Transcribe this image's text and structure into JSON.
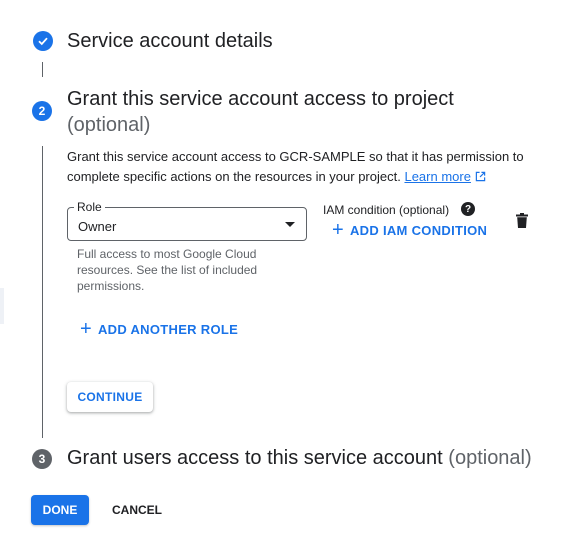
{
  "steps": [
    {
      "label": "Service account details",
      "state": "complete"
    },
    {
      "number": "2",
      "label": "Grant this service account access to project",
      "optional": "(optional)",
      "state": "active"
    },
    {
      "number": "3",
      "label": "Grant users access to this service account",
      "optional": "(optional)",
      "state": "pending"
    }
  ],
  "grant": {
    "description": "Grant this service account access to GCR-SAMPLE so that it has permission to complete specific actions on the resources in your project.",
    "learn_more": "Learn more",
    "role_label": "Role",
    "role_value": "Owner",
    "role_helper": "Full access to most Google Cloud resources. See the list of included permissions.",
    "iam_condition_label": "IAM condition (optional)",
    "add_iam_condition": "ADD IAM CONDITION",
    "add_another_role": "ADD ANOTHER ROLE",
    "continue": "CONTINUE"
  },
  "footer": {
    "done": "DONE",
    "cancel": "CANCEL"
  },
  "icons": {
    "check": "check-icon",
    "help": "help-icon",
    "delete": "trash-icon",
    "add": "plus-icon",
    "external": "open-in-new-icon",
    "dropdown": "caret-down-icon"
  },
  "colors": {
    "primary": "#1a73e8",
    "text": "#202124",
    "secondary_text": "#5f6368",
    "pending_step": "#5f6368"
  }
}
